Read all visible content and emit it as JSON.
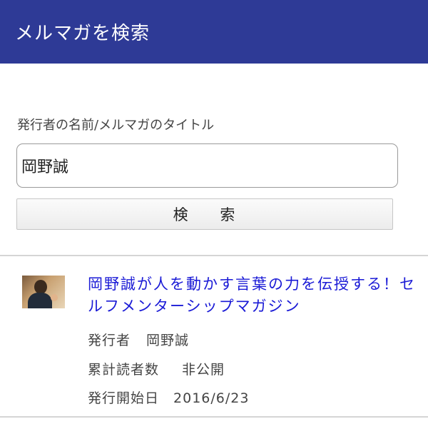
{
  "header": {
    "title": "メルマガを検索"
  },
  "search": {
    "label": "発行者の名前/メルマガのタイトル",
    "value": "岡野誠",
    "button_label": "検 索"
  },
  "result": {
    "title": "岡野誠が人を動かす言葉の力を伝授する！セルフメンターシップマガジン",
    "publisher_label": "発行者",
    "publisher": "岡野誠",
    "readers_label": "累計読者数",
    "readers": "非公開",
    "start_label": "発行開始日",
    "start_date": "2016/6/23"
  },
  "colors": {
    "header_bg": "#2e3a96",
    "link": "#1a1ad6"
  }
}
